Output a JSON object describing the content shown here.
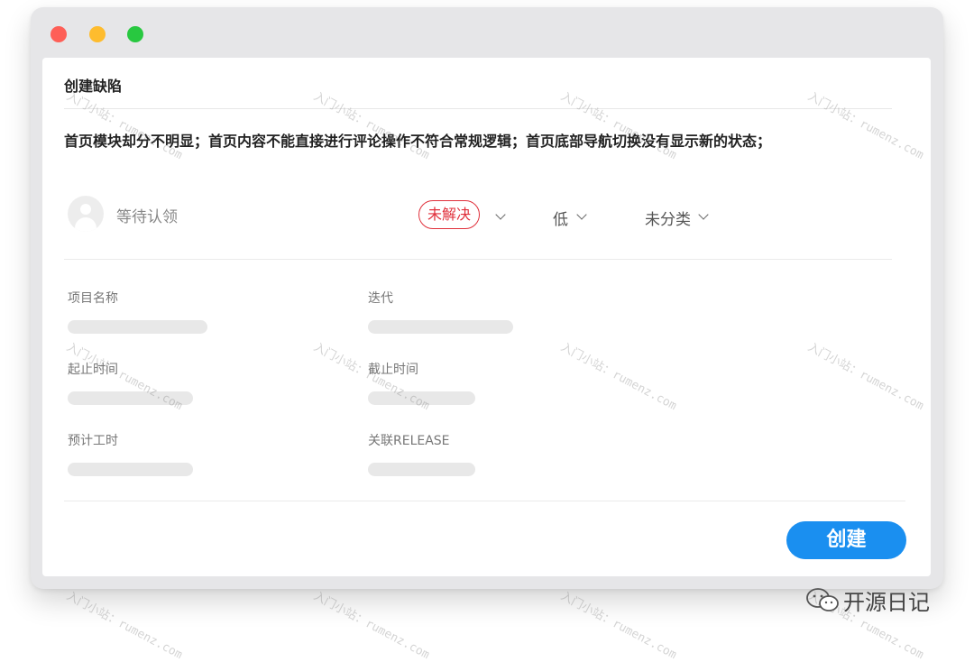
{
  "window": {
    "traffic_lights": {
      "close": "#fe5f57",
      "minimize": "#febc2e",
      "zoom": "#28c840"
    }
  },
  "dialog": {
    "title": "创建缺陷",
    "description": "首页模块却分不明显；首页内容不能直接进行评论操作不符合常规逻辑；首页底部导航切换没有显示新的状态；",
    "assignee_placeholder": "等待认领",
    "status": {
      "label": "未解决",
      "color": "#e0303b"
    },
    "priority": "低",
    "category": "未分类",
    "fields": {
      "project_name": "项目名称",
      "iteration": "迭代",
      "start_end_time": "起止时间",
      "deadline": "截止时间",
      "estimated_hours": "预计工时",
      "related_release": "关联RELEASE"
    },
    "create_button": {
      "label": "创建",
      "color": "#1a8ff0"
    }
  },
  "watermark_text": "入门小站：rumenz.com",
  "brand": {
    "name": "开源日记",
    "icon": "wechat-icon"
  }
}
